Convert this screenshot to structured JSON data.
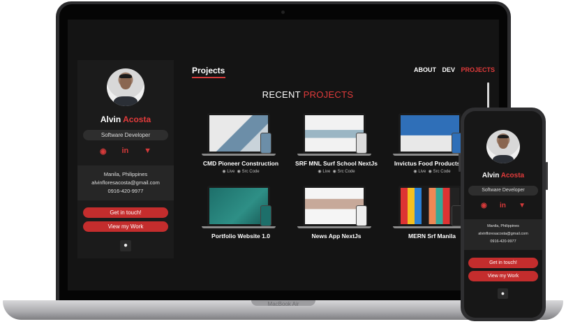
{
  "laptop": {
    "brand": "MacBook Air"
  },
  "profile": {
    "first_name": "Alvin",
    "last_name": "Acosta",
    "role": "Software Developer",
    "social_icons": [
      "github-icon",
      "linkedin-icon",
      "gitlab-icon"
    ],
    "location": "Manila, Philippines",
    "email": "alvinfloresacosta@gmail.com",
    "phone": "0916-420-9977",
    "cta_contact": "Get in touch!",
    "cta_work": "View my Work",
    "theme_toggle_icon": "lightbulb-icon"
  },
  "nav": {
    "title": "Projects",
    "items": [
      {
        "label": "ABOUT",
        "active": false
      },
      {
        "label": "DEV",
        "active": false
      },
      {
        "label": "PROJECTS",
        "active": true
      }
    ]
  },
  "section": {
    "title_prefix": "RECENT",
    "title_highlight": "PROJECTS"
  },
  "projects": [
    {
      "title": "CMD Pioneer Construction",
      "live": "Live",
      "src": "Src Code"
    },
    {
      "title": "SRF MNL Surf School NextJs",
      "live": "Live",
      "src": "Src Code"
    },
    {
      "title": "Invictus Food Products Co",
      "live": "Live",
      "src": "Src Code"
    },
    {
      "title": "Portfolio Website 1.0"
    },
    {
      "title": "News App NextJs"
    },
    {
      "title": "MERN Srf Manila"
    }
  ],
  "colors": {
    "accent": "#e23b3b",
    "button": "#c42d2d",
    "background": "#141414",
    "card": "#1b1b1b"
  }
}
